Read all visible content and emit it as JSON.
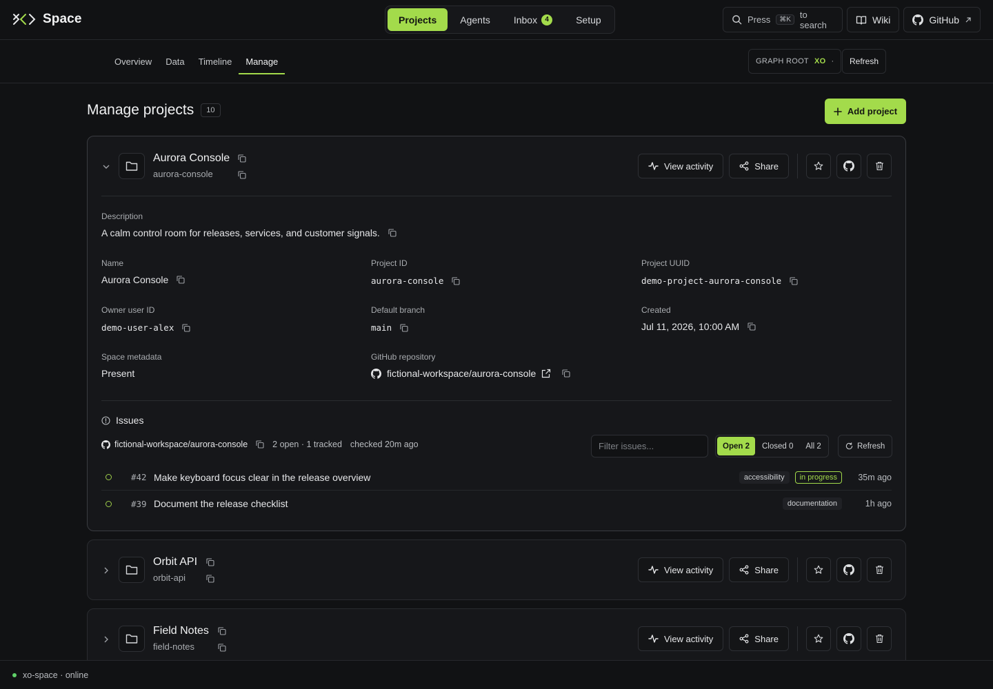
{
  "app": {
    "name": "Space"
  },
  "nav": {
    "items": [
      {
        "label": "Projects",
        "active": true
      },
      {
        "label": "Agents"
      },
      {
        "label": "Inbox",
        "badge": "4"
      },
      {
        "label": "Setup"
      }
    ]
  },
  "search": {
    "prefix": "Press",
    "shortcut": "⌘K",
    "suffix": "to search"
  },
  "top_links": {
    "wiki": "Wiki",
    "github": "GitHub"
  },
  "tabs": [
    {
      "label": "Overview"
    },
    {
      "label": "Data"
    },
    {
      "label": "Timeline"
    },
    {
      "label": "Manage",
      "active": true
    }
  ],
  "graph_root": {
    "label": "GRAPH ROOT",
    "value": "XO",
    "suffix": "·"
  },
  "refresh_label": "Refresh",
  "page": {
    "title": "Manage projects",
    "count": "10",
    "add_label": "Add project"
  },
  "action_labels": {
    "view_activity": "View activity",
    "share": "Share"
  },
  "projects": [
    {
      "name": "Aurora Console",
      "slug": "aurora-console",
      "expanded": true,
      "details": {
        "description_label": "Description",
        "description": "A calm control room for releases, services, and customer signals.",
        "name_label": "Name",
        "name": "Aurora Console",
        "project_id_label": "Project ID",
        "project_id": "aurora-console",
        "uuid_label": "Project UUID",
        "uuid": "demo-project-aurora-console",
        "owner_label": "Owner user ID",
        "owner": "demo-user-alex",
        "branch_label": "Default branch",
        "branch": "main",
        "created_label": "Created",
        "created": "Jul 11, 2026, 10:00 AM",
        "metadata_label": "Space metadata",
        "metadata": "Present",
        "repo_label": "GitHub repository",
        "repo": "fictional-workspace/aurora-console"
      },
      "issues": {
        "title": "Issues",
        "repo": "fictional-workspace/aurora-console",
        "summary": "2 open · 1 tracked",
        "checked": "checked 20m ago",
        "filter_placeholder": "Filter issues...",
        "segments": [
          {
            "label": "Open 2",
            "active": true
          },
          {
            "label": "Closed 0"
          },
          {
            "label": "All 2"
          }
        ],
        "refresh_label": "Refresh",
        "items": [
          {
            "number": "#42",
            "title": "Make keyboard focus clear in the release overview",
            "tags": [
              "accessibility",
              "in progress"
            ],
            "time": "35m ago"
          },
          {
            "number": "#39",
            "title": "Document the release checklist",
            "tags": [
              "documentation"
            ],
            "time": "1h ago"
          }
        ]
      }
    },
    {
      "name": "Orbit API",
      "slug": "orbit-api",
      "expanded": false
    },
    {
      "name": "Field Notes",
      "slug": "field-notes",
      "expanded": false
    }
  ],
  "status": {
    "text": "xo-space · online"
  },
  "colors": {
    "accent": "#a3db4b",
    "background": "#111214",
    "card": "#16171a",
    "online": "#5fd068"
  }
}
